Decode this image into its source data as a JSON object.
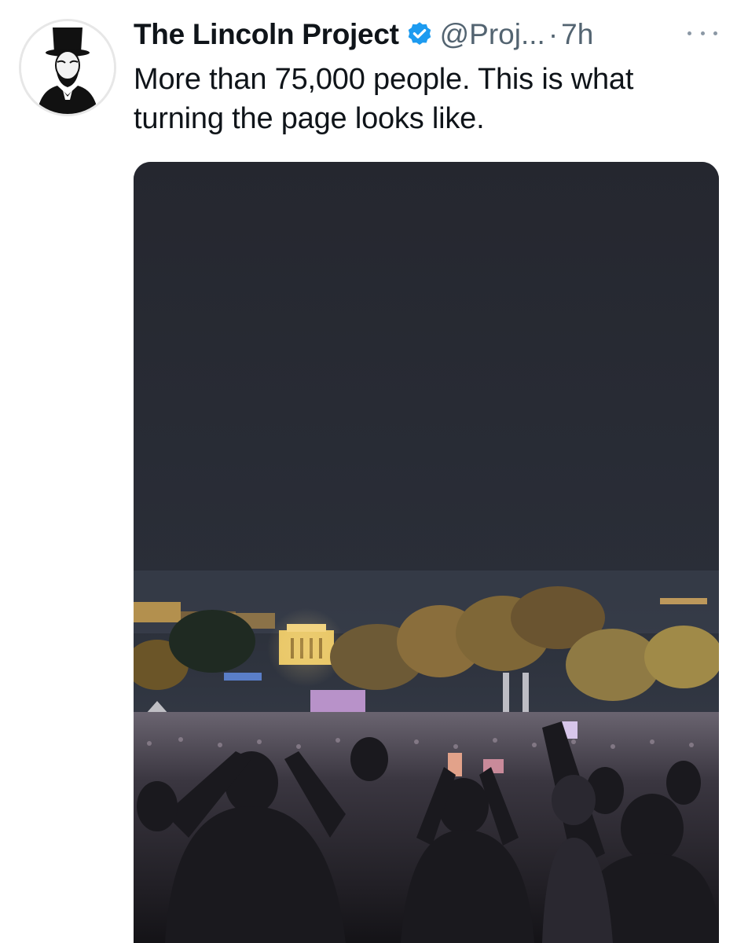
{
  "tweet": {
    "display_name": "The Lincoln Project",
    "handle": "@Proj...",
    "separator": "·",
    "time": "7h",
    "text": "More than 75,000 people. This is what turning the page looks like.",
    "verified": true
  },
  "icons": {
    "avatar": "lincoln-portrait-icon",
    "verified": "verified-badge-icon",
    "more": "more-options-icon"
  },
  "colors": {
    "verified_blue": "#1d9bf0",
    "muted_text": "#536471",
    "primary_text": "#0f1419"
  }
}
